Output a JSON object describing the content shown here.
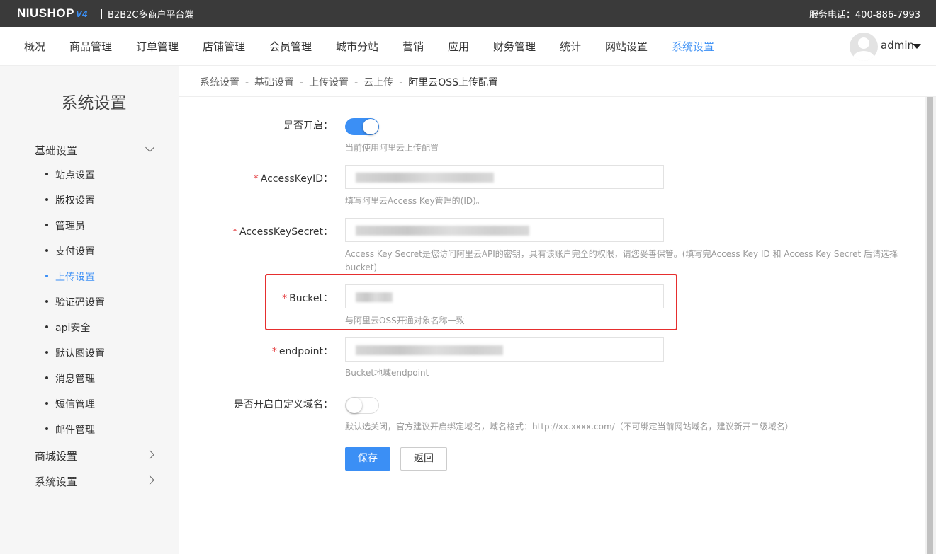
{
  "header": {
    "logo": "NIUSHOP",
    "logo_version": "V4",
    "platform_name": "B2B2C多商户平台端",
    "hotline": "服务电话：400-886-7993"
  },
  "nav": {
    "items": [
      "概况",
      "商品管理",
      "订单管理",
      "店铺管理",
      "会员管理",
      "城市分站",
      "营销",
      "应用",
      "财务管理",
      "统计",
      "网站设置",
      "系统设置"
    ],
    "active": "系统设置",
    "user": "admin"
  },
  "sidebar": {
    "title": "系统设置",
    "groups": [
      {
        "label": "基础设置",
        "expanded": true
      },
      {
        "label": "商城设置",
        "expanded": false
      },
      {
        "label": "系统设置",
        "expanded": false
      }
    ],
    "sub_items": [
      "站点设置",
      "版权设置",
      "管理员",
      "支付设置",
      "上传设置",
      "验证码设置",
      "api安全",
      "默认图设置",
      "消息管理",
      "短信管理",
      "邮件管理"
    ],
    "active_sub": "上传设置"
  },
  "breadcrumb": [
    "系统设置",
    "基础设置",
    "上传设置",
    "云上传",
    "阿里云OSS上传配置"
  ],
  "breadcrumb_sep": "-",
  "form": {
    "enable": {
      "label": "是否开启：",
      "on": true,
      "hint": "当前使用阿里云上传配置"
    },
    "access_key_id": {
      "label": "AccessKeyID：",
      "value": "",
      "hint": "填写阿里云Access Key管理的(ID)。"
    },
    "access_key_secret": {
      "label": "AccessKeySecret：",
      "value": "",
      "hint": "Access Key Secret是您访问阿里云API的密钥，具有该账户完全的权限，请您妥善保管。(填写完Access Key ID 和 Access Key Secret 后请选择",
      "hint_line2": "bucket)"
    },
    "bucket": {
      "label": "Bucket：",
      "value": "",
      "hint": "与阿里云OSS开通对象名称一致"
    },
    "endpoint": {
      "label": "endpoint：",
      "value": "",
      "hint": "Bucket地域endpoint"
    },
    "custom_domain": {
      "label": "是否开启自定义域名：",
      "on": false,
      "hint": "默认选关闭，官方建议开启绑定域名，域名格式：http://xx.xxxx.com/（不可绑定当前网站域名，建议新开二级域名）"
    },
    "required_mark": "*",
    "save_label": "保存",
    "back_label": "返回"
  },
  "colors": {
    "accent": "#3b8ff5",
    "topbar": "#3a3a3a",
    "required": "#e4393c",
    "highlight": "#e62e2e"
  }
}
